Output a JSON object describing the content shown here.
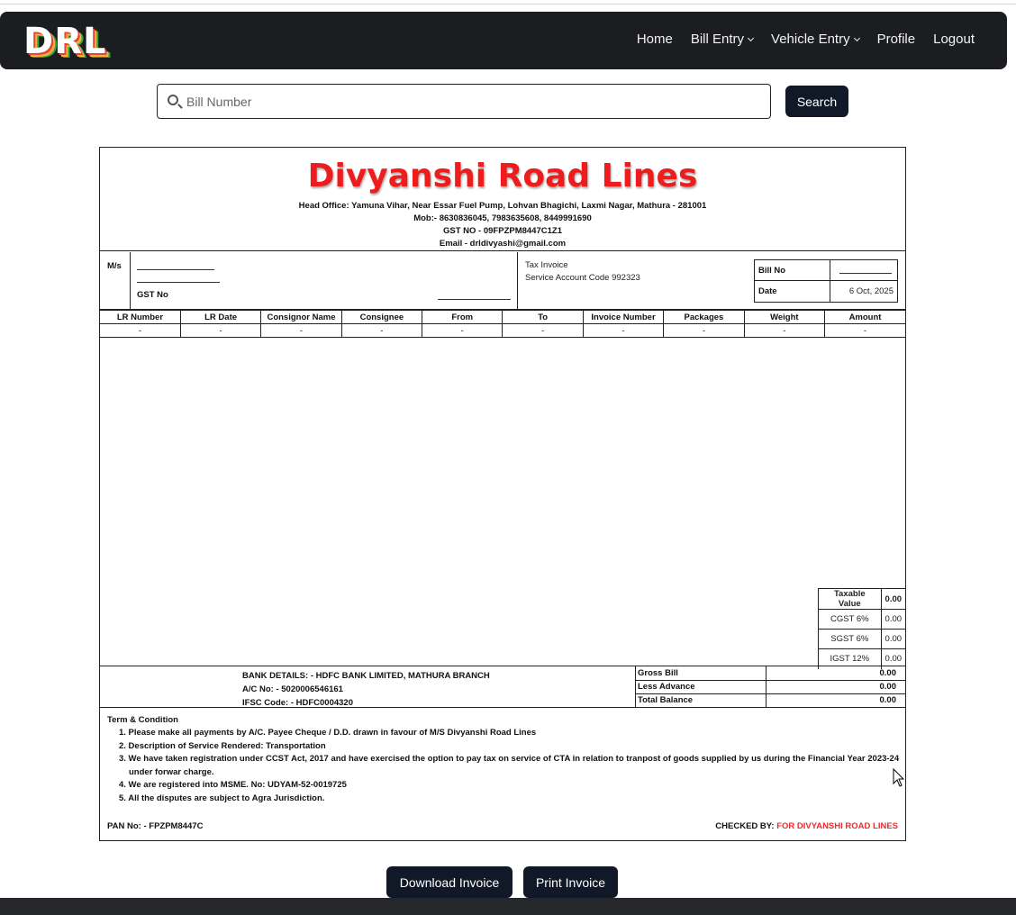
{
  "nav": {
    "logo": "DRL",
    "links": {
      "home": "Home",
      "bill_entry": "Bill Entry",
      "vehicle_entry": "Vehicle Entry",
      "profile": "Profile",
      "logout": "Logout"
    }
  },
  "search": {
    "placeholder": "Bill Number",
    "value": "",
    "button": "Search"
  },
  "invoice": {
    "company": "Divyanshi Road Lines",
    "head_office": "Head Office: Yamuna Vihar, Near Essar Fuel Pump, Lohvan Bhagichi, Laxmi Nagar, Mathura - 281001",
    "mobile": "Mob:- 8630836045, 7983635608, 8449991690",
    "gst": "GST NO - 09FPZPM8447C1Z1",
    "email": "Email - drldivyashi@gmail.com",
    "ms_label": "M/s",
    "gst_label": "GST No",
    "tax_invoice": "Tax Invoice",
    "service_code": "Service Account Code 992323",
    "bill_no_label": "Bill No",
    "bill_no_value": "",
    "date_label": "Date",
    "date_value": "6 Oct, 2025",
    "columns": [
      "LR Number",
      "LR Date",
      "Consignor Name",
      "Consignee",
      "From",
      "To",
      "Invoice Number",
      "Packages",
      "Weight",
      "Amount"
    ],
    "row": [
      "-",
      "-",
      "-",
      "-",
      "-",
      "-",
      "-",
      "-",
      "-",
      "-"
    ],
    "tax": {
      "taxable_label": "Taxable Value",
      "taxable_value": "0.00",
      "cgst_label": "CGST 6%",
      "cgst_value": "0.00",
      "sgst_label": "SGST 6%",
      "sgst_value": "0.00",
      "igst_label": "IGST 12%",
      "igst_value": "0.00"
    },
    "bank": {
      "details": "BANK DETAILS: - HDFC BANK LIMITED, MATHURA BRANCH",
      "account": "A/C No: - 5020006546161",
      "ifsc": "IFSC Code: - HDFC0004320"
    },
    "totals": {
      "gross_label": "Gross Bill",
      "gross_value": "0.00",
      "advance_label": "Less Advance",
      "advance_value": "0.00",
      "balance_label": "Total Balance",
      "balance_value": "0.00"
    },
    "terms_title": "Term & Condition",
    "terms": [
      "1. Please make all payments by A/C. Payee Cheque / D.D. drawn in favour of M/S Divyanshi Road Lines",
      "2. Description of Service Rendered: Transportation",
      "3. We have taken registration under CCST Act, 2017 and have exercised the option to pay tax on service of CTA in relation to tranpost of goods supplied by us during the Financial Year 2023-24 under forwar charge.",
      "4. We are registered into MSME. No: UDYAM-52-0019725",
      "5. All the disputes are subject to Agra Jurisdiction."
    ],
    "pan": "PAN No: - FPZPM8447C",
    "checked_by": "CHECKED BY:",
    "checked_for": "FOR DIVYANSHI ROAD LINES"
  },
  "actions": {
    "download": "Download Invoice",
    "print": "Print Invoice"
  },
  "colors": {
    "navbar": "#1c1d21",
    "button": "#111827",
    "brand_red": "#ee1c1c"
  }
}
